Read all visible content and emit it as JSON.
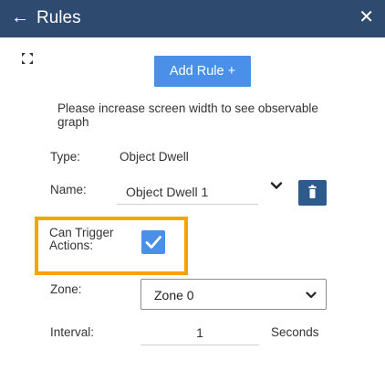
{
  "header": {
    "back_icon": "arrow-left-icon",
    "back_glyph": "←",
    "title": "Rules",
    "close_icon": "close-icon",
    "close_glyph": "✕",
    "background": "#2e4a6e"
  },
  "toolbar": {
    "expand_icon": "expand-icon",
    "add_rule_label": "Add Rule +",
    "accent": "#4a90e8"
  },
  "notice": "Please increase screen width to see observable graph",
  "form": {
    "type_label": "Type:",
    "type_value": "Object Dwell",
    "name_label": "Name:",
    "name_value": "Object Dwell 1",
    "name_dropdown_icon": "chevron-down-icon",
    "delete_icon": "trash-icon",
    "trigger_label": "Can Trigger Actions:",
    "trigger_checked": true,
    "highlight_color": "#f4a300",
    "zone_label": "Zone:",
    "zone_value": "Zone 0",
    "interval_label": "Interval:",
    "interval_value": "1",
    "interval_unit": "Seconds"
  }
}
